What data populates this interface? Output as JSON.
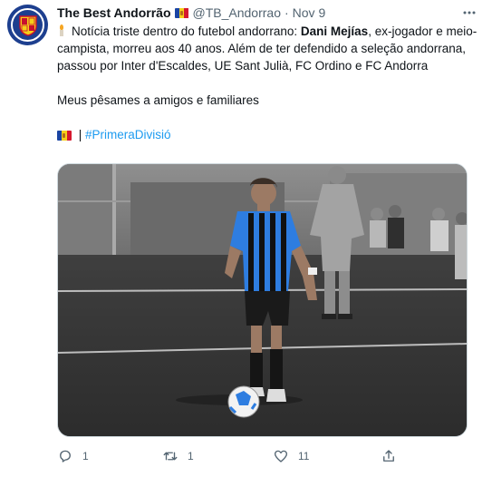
{
  "tweet": {
    "author_name": "The Best Andorrão",
    "handle": "@TB_Andorrao",
    "separator": "·",
    "date": "Nov 9",
    "body_prefix": "Notícia triste dentro do futebol andorrano: ",
    "body_bold": "Dani Mejías",
    "body_suffix": ", ex-jogador e meio-campista, morreu aos 40 anos. Além de ter defendido a seleção andorrana, passou por Inter d'Escaldes, UE Sant Julià, FC Ordino e FC Andorra",
    "condolence": "Meus pêsames a amigos e familiares",
    "tag_separator": "|",
    "hashtag": "#PrimeraDivisió"
  },
  "metrics": {
    "replies": "1",
    "retweets": "1",
    "likes": "11"
  },
  "icons": {
    "avatar": "andorra-coat-of-arms-icon",
    "flag": "andorra-flag-icon",
    "candle": "candle-icon",
    "more": "more-options-icon",
    "reply": "reply-icon",
    "retweet": "retweet-icon",
    "like": "heart-icon",
    "share": "share-icon"
  },
  "colors": {
    "link": "#1d9bf0",
    "muted": "#536471",
    "text": "#0f1419",
    "kit_blue": "#2e7de0"
  }
}
